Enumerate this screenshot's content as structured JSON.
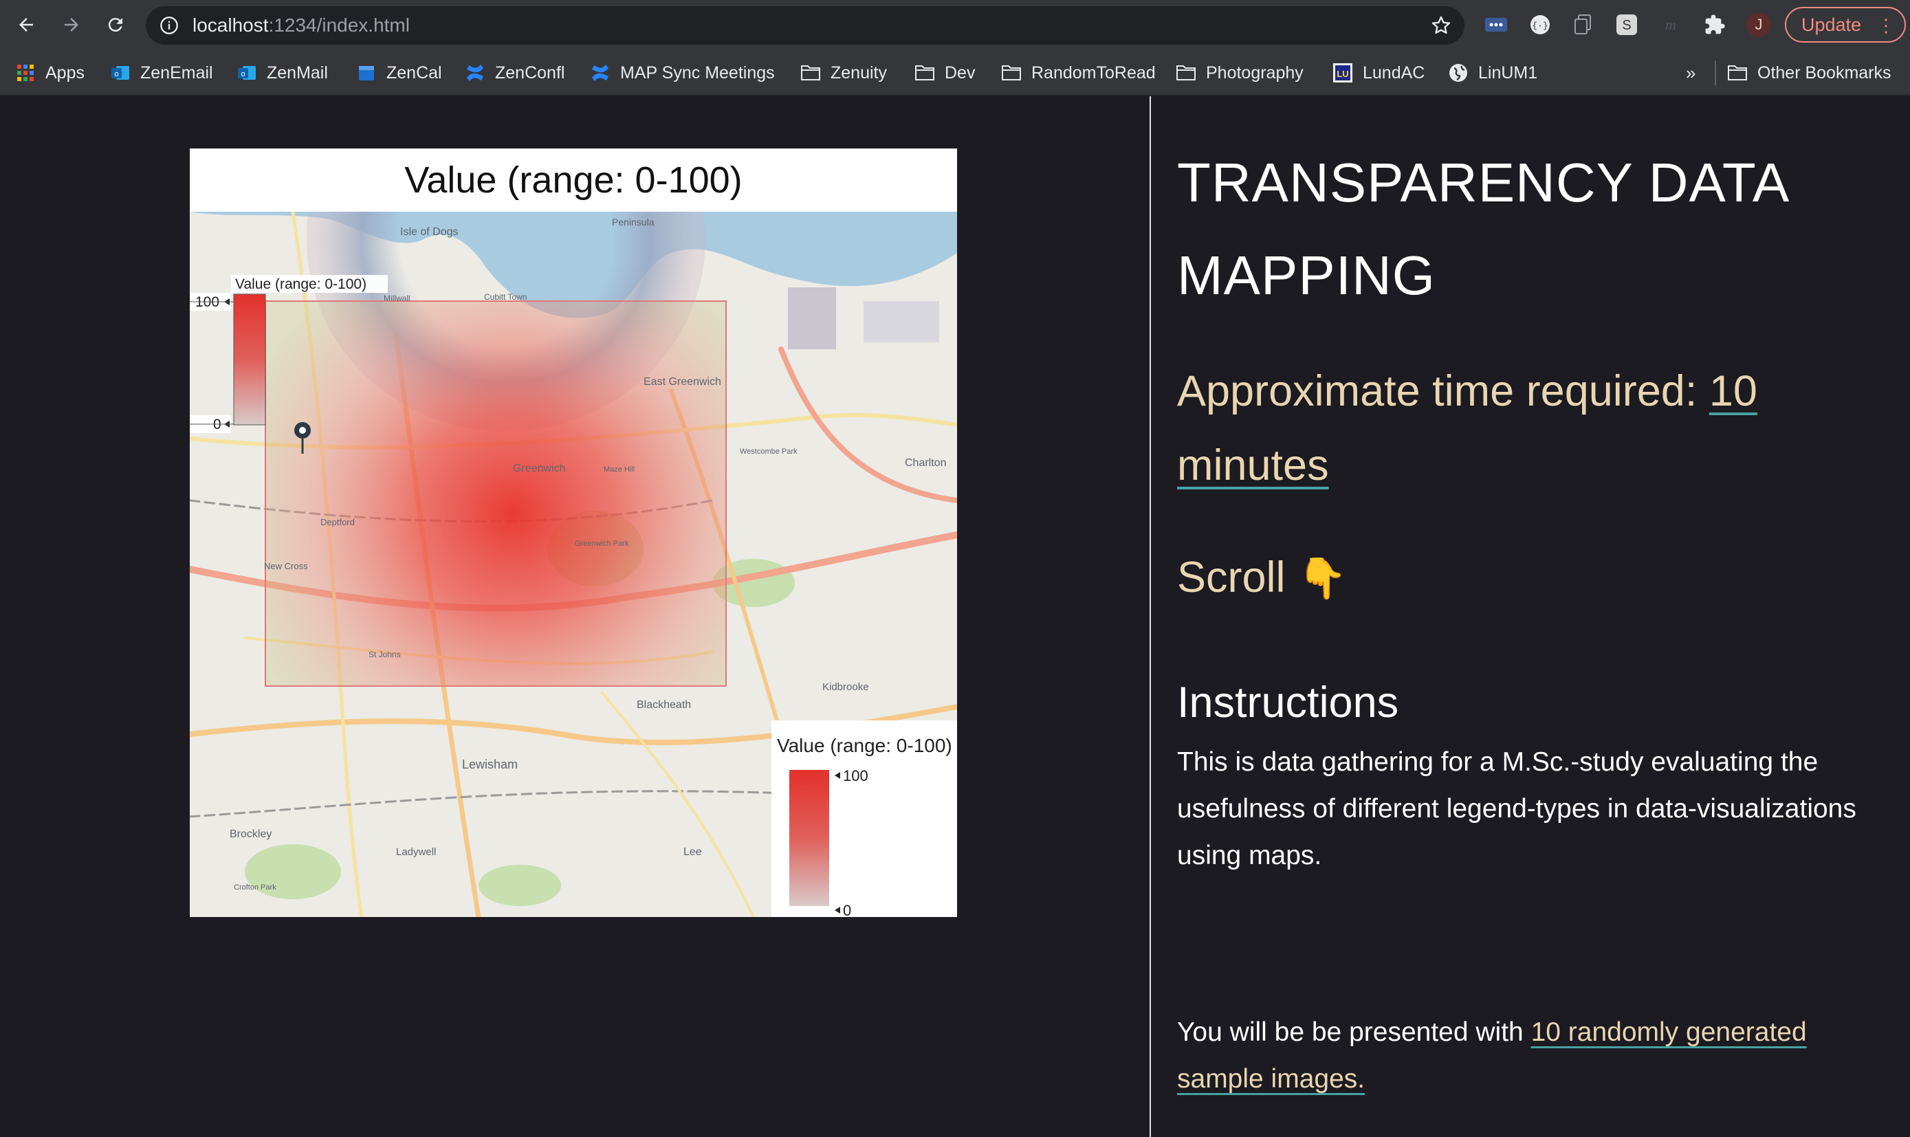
{
  "browser": {
    "url_host": "localhost",
    "url_path": ":1234/index.html",
    "profile_initial": "J",
    "update_label": "Update",
    "bookmarks": [
      "Apps",
      "ZenEmail",
      "ZenMail",
      "ZenCal",
      "ZenConfl",
      "MAP Sync Meetings",
      "Zenuity",
      "Dev",
      "RandomToRead",
      "Photography",
      "LundAC",
      "LinUM1"
    ],
    "overflow_label": "»",
    "other_bookmarks": "Other Bookmarks"
  },
  "map": {
    "title": "Value (range: 0-100)",
    "small_legend": {
      "title": "Value (range: 0-100)",
      "max_label": "100",
      "min_label": "0"
    },
    "big_legend": {
      "title": "Value (range: 0-100)",
      "max_label": "100",
      "min_label": "0"
    },
    "place_labels": [
      "Greenwich",
      "Lewisham",
      "Brockley",
      "Blackheath",
      "Charlton",
      "East Greenwich",
      "Deptford",
      "New Cross",
      "Lee",
      "Ladywell",
      "Kidbrooke",
      "Westcombe Park",
      "Maze Hill",
      "Greenwich Park",
      "St Johns",
      "Cubitt Town",
      "Isle of Dogs",
      "Millwall",
      "Peninsula",
      "Crofton Park"
    ],
    "heat_colors": {
      "high": "#e8322b",
      "low": "#b8c27a"
    }
  },
  "panel": {
    "title": "TRANSPARENCY DATA MAPPING",
    "time_prefix": "Approximate time required: ",
    "time_link": "10 minutes",
    "scroll_label": "Scroll",
    "scroll_emoji": "👇",
    "instructions_title": "Instructions",
    "instructions_body": "This is data gathering for a M.Sc.-study evaluating the usefulness of different legend-types in data-visualizations using maps.",
    "present_prefix": "You will be be presented with ",
    "present_link": "10 randomly generated sample images."
  }
}
